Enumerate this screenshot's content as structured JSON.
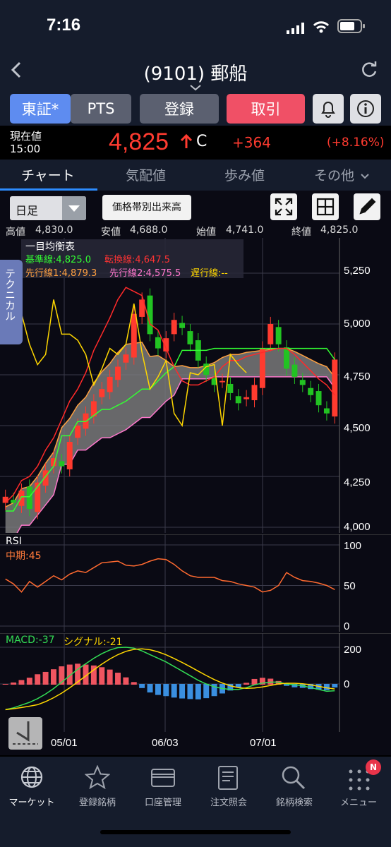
{
  "status": {
    "time": "7:16"
  },
  "header": {
    "title": "(9101) 郵船"
  },
  "buttons": {
    "exchange": "東証*",
    "pts": "PTS",
    "register": "登録",
    "trade": "取引"
  },
  "price": {
    "label": "現在値",
    "time": "15:00",
    "value": "4,825",
    "flag": "C",
    "change": "+364",
    "change_pct": "(+8.16%)"
  },
  "tabs": [
    "チャート",
    "気配値",
    "歩み値",
    "その他"
  ],
  "toolbar": {
    "period": "日足",
    "volume_button": "価格帯別出来高"
  },
  "ohlc": {
    "high_label": "高値",
    "high": "4,830.0",
    "low_label": "安値",
    "low": "4,688.0",
    "open_label": "始値",
    "open": "4,741.0",
    "close_label": "終値",
    "close": "4,825.0"
  },
  "ichimoku": {
    "title": "一目均衡表",
    "kijun": "基準線:4,825.0",
    "tenkan": "転換線:4,647.5",
    "span1": "先行線1:4,879.3",
    "span2": "先行線2:4,575.5",
    "chikou": "遅行線:--"
  },
  "side_tab": "テクニカル",
  "rsi": {
    "title": "RSI",
    "period": "中期:45"
  },
  "macd": {
    "macd": "MACD:-37",
    "signal": "シグナル:-21"
  },
  "colors": {
    "up": "#ff3b2f",
    "down": "#22c322",
    "kijun": "#33ff33",
    "tenkan": "#ff2a2a",
    "chikou": "#ffd700",
    "span2": "#ff77cc",
    "cloud": "#808080"
  },
  "chart_data": [
    {
      "type": "candlestick",
      "title": "",
      "yticks": [
        "5,250",
        "5,000",
        "4,750",
        "4,500",
        "4,250",
        "4,000"
      ],
      "ylim": [
        4000,
        5300
      ],
      "xticks": [
        "05/01",
        "06/03",
        "07/01"
      ],
      "series": [
        {
          "name": "基準線",
          "values": [
            4080,
            4080,
            4150,
            4150,
            4200,
            4250,
            4300,
            4450,
            4450,
            4520,
            4520,
            4550,
            4580,
            4580,
            4600,
            4620,
            4650,
            4680,
            4680,
            4720,
            4760,
            4790,
            4870,
            4870,
            4870,
            4870,
            4880,
            4880,
            4880,
            4880,
            4880,
            4880,
            4880,
            4880,
            4880,
            4880,
            4880,
            4880,
            4880,
            4880,
            4880,
            4825
          ]
        },
        {
          "name": "転換線",
          "values": [
            4120,
            4160,
            4230,
            4250,
            4300,
            4380,
            4440,
            4530,
            4620,
            4680,
            4760,
            4870,
            4950,
            5030,
            5120,
            5180,
            5160,
            5140,
            5000,
            4970,
            4880,
            4790,
            4720,
            4700,
            4700,
            4720,
            4740,
            4790,
            4820,
            4820,
            4840,
            4850,
            4860,
            4870,
            4880,
            4880,
            4850,
            4810,
            4770,
            4730,
            4700,
            4650
          ]
        },
        {
          "name": "遅行線",
          "values": [
            4920,
            5150,
            5050,
            4900,
            4800,
            4850,
            5120,
            4950,
            4950,
            4920,
            4850,
            4700,
            4780,
            4880,
            4850,
            4900,
            5100,
            4860,
            4680,
            4740,
            4820,
            4560,
            4500,
            4760,
            4750,
            4790,
            4800,
            4500,
            4850,
            4800,
            4760
          ]
        },
        {
          "name": "RSI",
          "values": [
            58,
            52,
            42,
            55,
            48,
            55,
            62,
            57,
            64,
            68,
            66,
            72,
            78,
            79,
            80,
            75,
            74,
            76,
            80,
            83,
            82,
            76,
            68,
            62,
            60,
            60,
            60,
            56,
            55,
            52,
            50,
            48,
            42,
            44,
            50,
            66,
            60,
            56,
            55,
            53,
            50,
            45
          ]
        },
        {
          "name": "MACD",
          "values": [
            -140,
            -130,
            -115,
            -100,
            -80,
            -55,
            -25,
            10,
            45,
            80,
            110,
            140,
            165,
            185,
            198,
            200,
            195,
            180,
            160,
            140,
            120,
            95,
            70,
            45,
            20,
            0,
            -15,
            -25,
            -30,
            -30,
            -20,
            -5,
            5,
            10,
            10,
            0,
            -5,
            -10,
            -20,
            -30,
            -40,
            -37
          ]
        }
      ]
    }
  ],
  "nav": [
    {
      "label": "マーケット",
      "icon": "globe-icon"
    },
    {
      "label": "登録銘柄",
      "icon": "star-icon"
    },
    {
      "label": "口座管理",
      "icon": "card-icon"
    },
    {
      "label": "注文照会",
      "icon": "document-icon"
    },
    {
      "label": "銘柄検索",
      "icon": "search-icon"
    },
    {
      "label": "メニュー",
      "icon": "grid-icon"
    }
  ],
  "nav_badge": "N"
}
